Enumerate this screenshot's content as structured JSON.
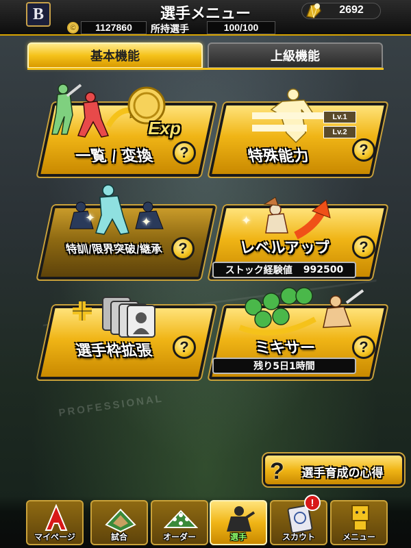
{
  "header": {
    "title": "選手メニュー",
    "team_logo_letter": "B",
    "gem_count": "2692",
    "coin_symbol": "©",
    "money": "1127860",
    "owned_label": "所持選手",
    "owned_count": "100/100"
  },
  "tabs": [
    {
      "label": "基本機能",
      "active": true
    },
    {
      "label": "上級機能",
      "active": false
    }
  ],
  "cards": {
    "list_convert": {
      "label": "一覧 / 変換",
      "badge": "Exp"
    },
    "special_ability": {
      "label": "特殊能力",
      "lv1": "Lv.1",
      "lv2": "Lv.2"
    },
    "training": {
      "label": "特訓/限界突破/継承"
    },
    "level_up": {
      "label": "レベルアップ",
      "stock_label": "ストック経験値",
      "stock_value": "992500"
    },
    "expand_slots": {
      "label": "選手枠拡張"
    },
    "mixer": {
      "label": "ミキサー",
      "remaining": "残り5日1時間"
    }
  },
  "help_symbol": "?",
  "tips_button": {
    "label": "選手育成の心得",
    "symbol": "?"
  },
  "bottom_nav": [
    {
      "label": "マイページ",
      "icon": "a-logo-icon"
    },
    {
      "label": "試合",
      "icon": "stadium-icon"
    },
    {
      "label": "オーダー",
      "icon": "field-order-icon"
    },
    {
      "label": "選手",
      "icon": "player-icon",
      "active": true
    },
    {
      "label": "スカウト",
      "icon": "scout-card-icon"
    },
    {
      "label": "メニュー",
      "icon": "menu-character-icon"
    }
  ],
  "alert_badge": "!",
  "background_logo": {
    "sub": "PROFESSIONAL"
  },
  "colors": {
    "gold": "#f0b516",
    "header_bg": "#0d0d0d",
    "alert_red": "#d81818"
  }
}
